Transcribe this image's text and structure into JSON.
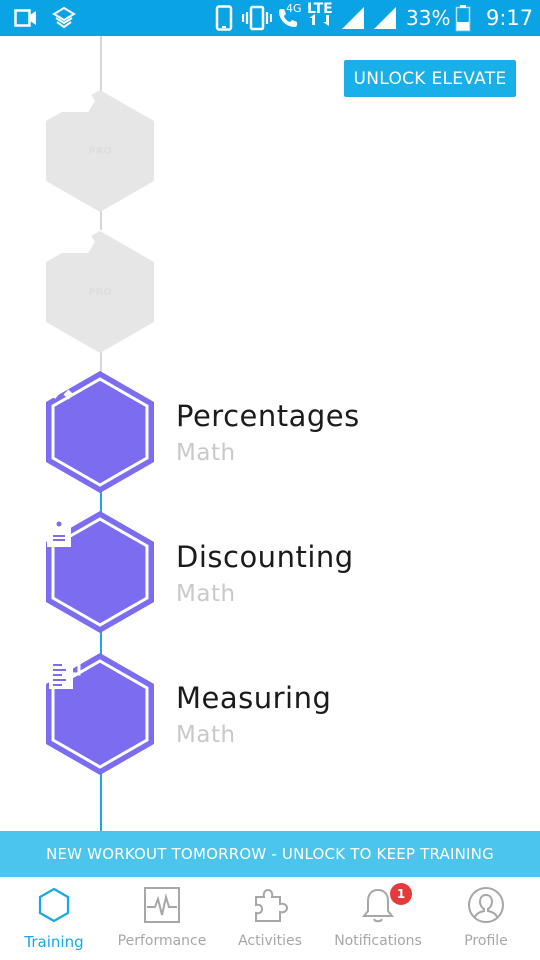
{
  "status_bar": {
    "network": "4G",
    "lte": "LTE",
    "battery_percent": "33%",
    "time": "9:17"
  },
  "unlock_button": "UNLOCK ELEVATE",
  "locked_items": [
    {
      "badge": "PRO"
    },
    {
      "badge": "PRO"
    }
  ],
  "lessons": [
    {
      "title": "Percentages",
      "subject": "Math",
      "icon": "percent-icon"
    },
    {
      "title": "Discounting",
      "subject": "Math",
      "icon": "price-tag-icon"
    },
    {
      "title": "Measuring",
      "subject": "Math",
      "icon": "measuring-cup-icon"
    }
  ],
  "banner": "NEW WORKOUT TOMORROW - UNLOCK TO KEEP TRAINING",
  "nav": {
    "training": "Training",
    "performance": "Performance",
    "activities": "Activities",
    "notifications": "Notifications",
    "profile": "Profile",
    "notifications_badge": "1"
  },
  "colors": {
    "status_bar": "#0aa3e3",
    "accent": "#19b0ea",
    "lesson_hex": "#7b6cf0",
    "locked_hex": "#e6e6e6",
    "badge": "#e83a3a"
  }
}
